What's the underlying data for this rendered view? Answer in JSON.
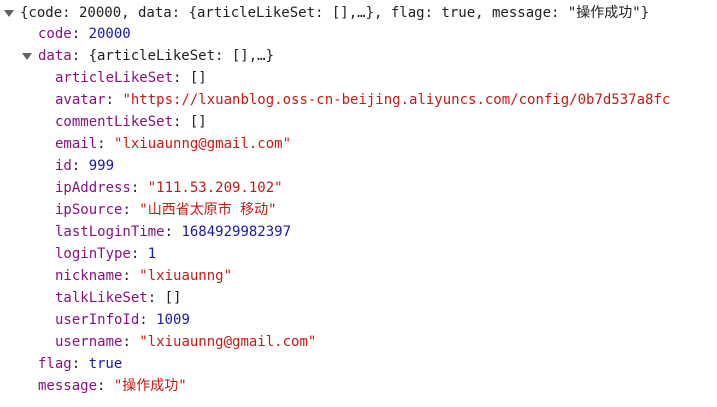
{
  "root": {
    "preview": "{code: 20000, data: {articleLikeSet: [],…}, flag: true, message: \"操作成功\"}",
    "code": {
      "key": "code",
      "value": "20000"
    },
    "data": {
      "key": "data",
      "preview": "{articleLikeSet: [],…}",
      "fields": {
        "articleLikeSet": {
          "key": "articleLikeSet",
          "value": "[]"
        },
        "avatar": {
          "key": "avatar",
          "value": "\"https://lxuanblog.oss-cn-beijing.aliyuncs.com/config/0b7d537a8fc"
        },
        "commentLikeSet": {
          "key": "commentLikeSet",
          "value": "[]"
        },
        "email": {
          "key": "email",
          "value": "\"lxiuaunng@gmail.com\""
        },
        "id": {
          "key": "id",
          "value": "999"
        },
        "ipAddress": {
          "key": "ipAddress",
          "value": "\"111.53.209.102\""
        },
        "ipSource": {
          "key": "ipSource",
          "value": "\"山西省太原市 移动\""
        },
        "lastLoginTime": {
          "key": "lastLoginTime",
          "value": "1684929982397"
        },
        "loginType": {
          "key": "loginType",
          "value": "1"
        },
        "nickname": {
          "key": "nickname",
          "value": "\"lxiuaunng\""
        },
        "talkLikeSet": {
          "key": "talkLikeSet",
          "value": "[]"
        },
        "userInfoId": {
          "key": "userInfoId",
          "value": "1009"
        },
        "username": {
          "key": "username",
          "value": "\"lxiuaunng@gmail.com\""
        }
      }
    },
    "flag": {
      "key": "flag",
      "value": "true"
    },
    "message": {
      "key": "message",
      "value": "\"操作成功\""
    }
  },
  "colors": {
    "key": "#881280",
    "string": "#c41a16",
    "number": "#1a1aa6",
    "boolean": "#1a1aa6",
    "text": "#202124",
    "arrow": "#5f6368"
  },
  "icons": {
    "expanded_toggle": "triangle-down-icon"
  }
}
